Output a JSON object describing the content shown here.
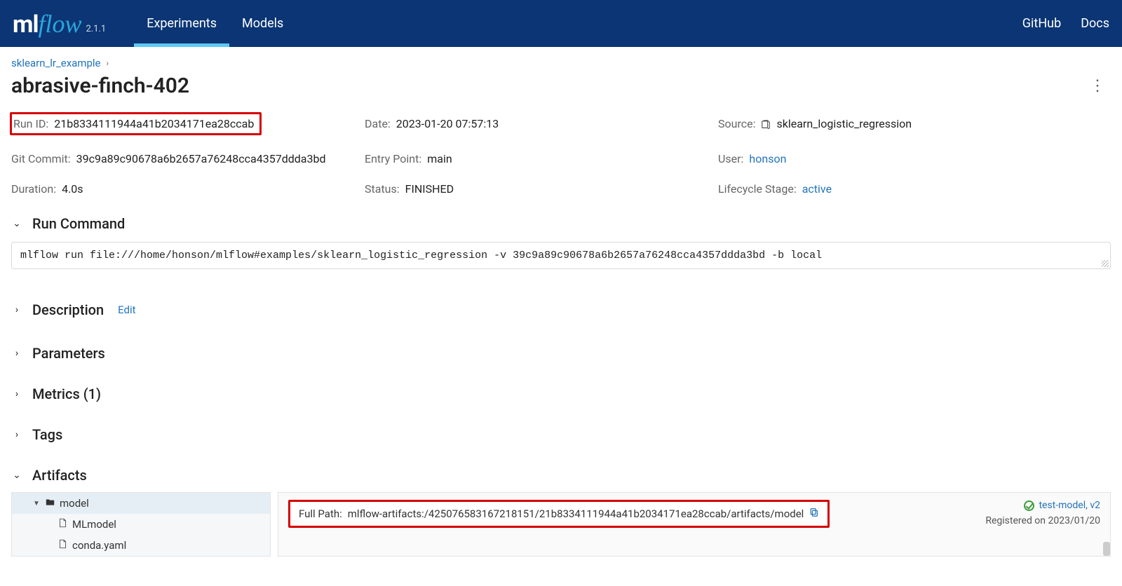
{
  "header": {
    "logo_ml": "ml",
    "logo_flow": "flow",
    "version": "2.1.1",
    "nav": {
      "experiments": "Experiments",
      "models": "Models"
    },
    "links": {
      "github": "GitHub",
      "docs": "Docs"
    }
  },
  "breadcrumb": {
    "experiment": "sklearn_lr_example"
  },
  "run": {
    "title": "abrasive-finch-402",
    "run_id_label": "Run ID:",
    "run_id": "21b8334111944a41b2034171ea28ccab",
    "date_label": "Date:",
    "date": "2023-01-20 07:57:13",
    "source_label": "Source:",
    "source": "sklearn_logistic_regression",
    "git_label": "Git Commit:",
    "git": "39c9a89c90678a6b2657a76248cca4357ddda3bd",
    "entry_label": "Entry Point:",
    "entry": "main",
    "user_label": "User:",
    "user": "honson",
    "duration_label": "Duration:",
    "duration": "4.0s",
    "status_label": "Status:",
    "status": "FINISHED",
    "lifecycle_label": "Lifecycle Stage:",
    "lifecycle": "active"
  },
  "sections": {
    "run_command": "Run Command",
    "description": "Description",
    "edit": "Edit",
    "parameters": "Parameters",
    "metrics": "Metrics (1)",
    "tags": "Tags",
    "artifacts": "Artifacts"
  },
  "run_command_text": "mlflow run file:///home/honson/mlflow#examples/sklearn_logistic_regression -v 39c9a89c90678a6b2657a76248cca4357ddda3bd -b local",
  "artifacts": {
    "tree": {
      "root": "model",
      "file1": "MLmodel",
      "file2": "conda.yaml"
    },
    "full_path_label": "Full Path:",
    "full_path": "mlflow-artifacts:/425076583167218151/21b8334111944a41b2034171ea28ccab/artifacts/model",
    "registered_model": "test-model, v2",
    "registered_on": "Registered on 2023/01/20"
  }
}
